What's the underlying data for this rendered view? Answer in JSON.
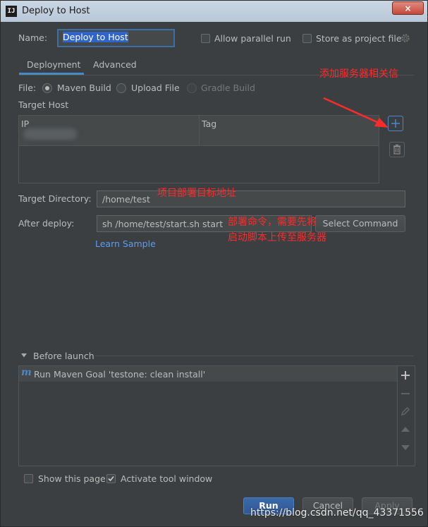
{
  "window": {
    "title": "Deploy to Host",
    "app_icon": "IJ",
    "close_glyph": "×"
  },
  "name_row": {
    "label": "Name:",
    "value": "Deploy to Host",
    "allow_parallel": "Allow parallel run",
    "store_project": "Store as project file"
  },
  "tabs": [
    {
      "label": "Deployment",
      "active": true
    },
    {
      "label": "Advanced",
      "active": false
    }
  ],
  "file": {
    "label": "File:",
    "options": [
      "Maven Build",
      "Upload File",
      "Gradle Build"
    ],
    "selected": "Maven Build"
  },
  "target_host": {
    "label": "Target Host",
    "columns": [
      "IP",
      "Tag"
    ]
  },
  "target_dir": {
    "label": "Target Directory:",
    "value": "/home/test"
  },
  "after_deploy": {
    "label": "After deploy:",
    "value": "sh  /home/test/start.sh start",
    "select_label": "Select Command",
    "learn_sample": "Learn Sample"
  },
  "annotations": {
    "add_server": "添加服务器相关信",
    "target_dir": "项目部署目标地址",
    "cmd_line1": "部署命令，需要先将",
    "cmd_line2": "启动脚本上传至服务器"
  },
  "before_launch": {
    "label": "Before launch",
    "items": [
      {
        "icon": "m",
        "label": "Run Maven Goal 'testone: clean install'"
      }
    ]
  },
  "bottom": {
    "show_page": "Show this page",
    "activate_tool": "Activate tool window",
    "run": "Run",
    "cancel": "Cancel",
    "apply": "Apply"
  },
  "watermark": "https://blog.csdn.net/qq_43371556",
  "colors": {
    "accent": "#4a88c7",
    "annotation": "#ff2a2a",
    "panel": "#3c3f41"
  }
}
